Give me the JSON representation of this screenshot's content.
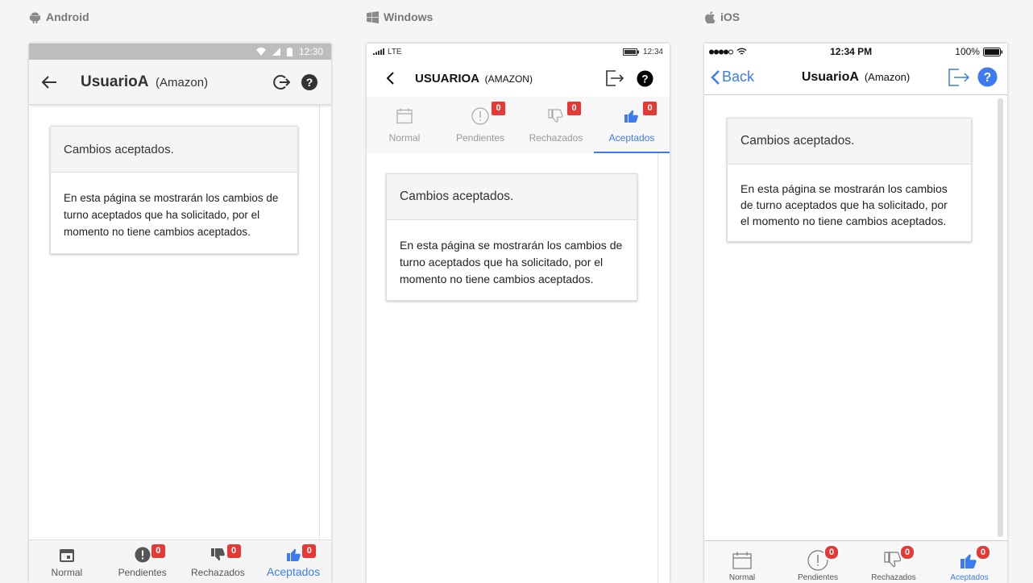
{
  "labels": {
    "android": "Android",
    "windows": "Windows",
    "ios": "iOS"
  },
  "colors": {
    "accent": "#3d7cf0",
    "badge": "#e53935"
  },
  "android": {
    "status_time": "12:30",
    "title": "UsuarioA",
    "subtitle": "(Amazon)",
    "card_title": "Cambios aceptados.",
    "card_body": "En esta página se mostrarán los cambios de turno aceptados que ha solicitado, por el momento no tiene cambios aceptados.",
    "nav": [
      {
        "label": "Normal",
        "icon": "calendar-icon"
      },
      {
        "label": "Pendientes",
        "icon": "exclamation-icon",
        "badge": "0"
      },
      {
        "label": "Rechazados",
        "icon": "thumbs-down-icon",
        "badge": "0"
      },
      {
        "label": "Aceptados",
        "icon": "thumbs-up-icon",
        "badge": "0"
      }
    ]
  },
  "windows": {
    "status_network": "LTE",
    "status_time": "12:34",
    "title": "USUARIOA",
    "subtitle": "(AMAZON)",
    "card_title": "Cambios aceptados.",
    "card_body": "En esta página se mostrarán los cambios de turno aceptados que ha solicitado, por el momento no tiene cambios aceptados.",
    "tabs": [
      {
        "label": "Normal",
        "icon": "calendar-icon"
      },
      {
        "label": "Pendientes",
        "icon": "exclamation-icon",
        "badge": "0"
      },
      {
        "label": "Rechazados",
        "icon": "thumbs-down-icon",
        "badge": "0"
      },
      {
        "label": "Aceptados",
        "icon": "thumbs-up-icon",
        "badge": "0"
      }
    ]
  },
  "ios": {
    "status_time": "12:34 PM",
    "status_battery": "100%",
    "back_label": "Back",
    "title": "UsuarioA",
    "subtitle": "(Amazon)",
    "card_title": "Cambios aceptados.",
    "card_body": "En esta página se mostrarán los cambios de turno aceptados que ha solicitado, por el momento no tiene cambios aceptados.",
    "tabs": [
      {
        "label": "Normal",
        "icon": "calendar-icon"
      },
      {
        "label": "Pendientes",
        "icon": "exclamation-icon",
        "badge": "0"
      },
      {
        "label": "Rechazados",
        "icon": "thumbs-down-icon",
        "badge": "0"
      },
      {
        "label": "Aceptados",
        "icon": "thumbs-up-icon",
        "badge": "0"
      }
    ]
  }
}
